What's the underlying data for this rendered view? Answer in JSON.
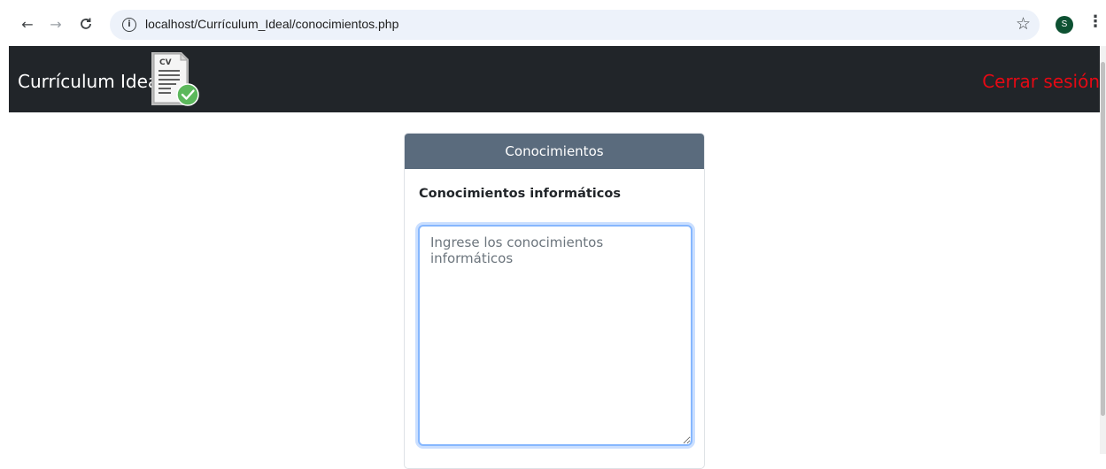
{
  "browser": {
    "url": "localhost/Currículum_Ideal/conocimientos.php",
    "profile_initial": "S",
    "nav_back_icon": "arrow-left-icon",
    "nav_forward_icon": "arrow-right-icon",
    "reload_icon": "reload-icon",
    "bookmark_icon": "star-icon",
    "menu_icon": "kebab-menu-icon",
    "profile_color": "#0d5132"
  },
  "navbar": {
    "brand": "Currículum Ideal",
    "logo_text": "CV",
    "logout": "Cerrar sesión",
    "background": "#212529",
    "logout_color": "#e50914"
  },
  "form": {
    "card_title": "Conocimientos",
    "label": "Conocimientos informáticos",
    "placeholder": "Ingrese los conocimientos informáticos",
    "header_color": "#5a6b7d",
    "focus_color": "#86b7fe"
  }
}
